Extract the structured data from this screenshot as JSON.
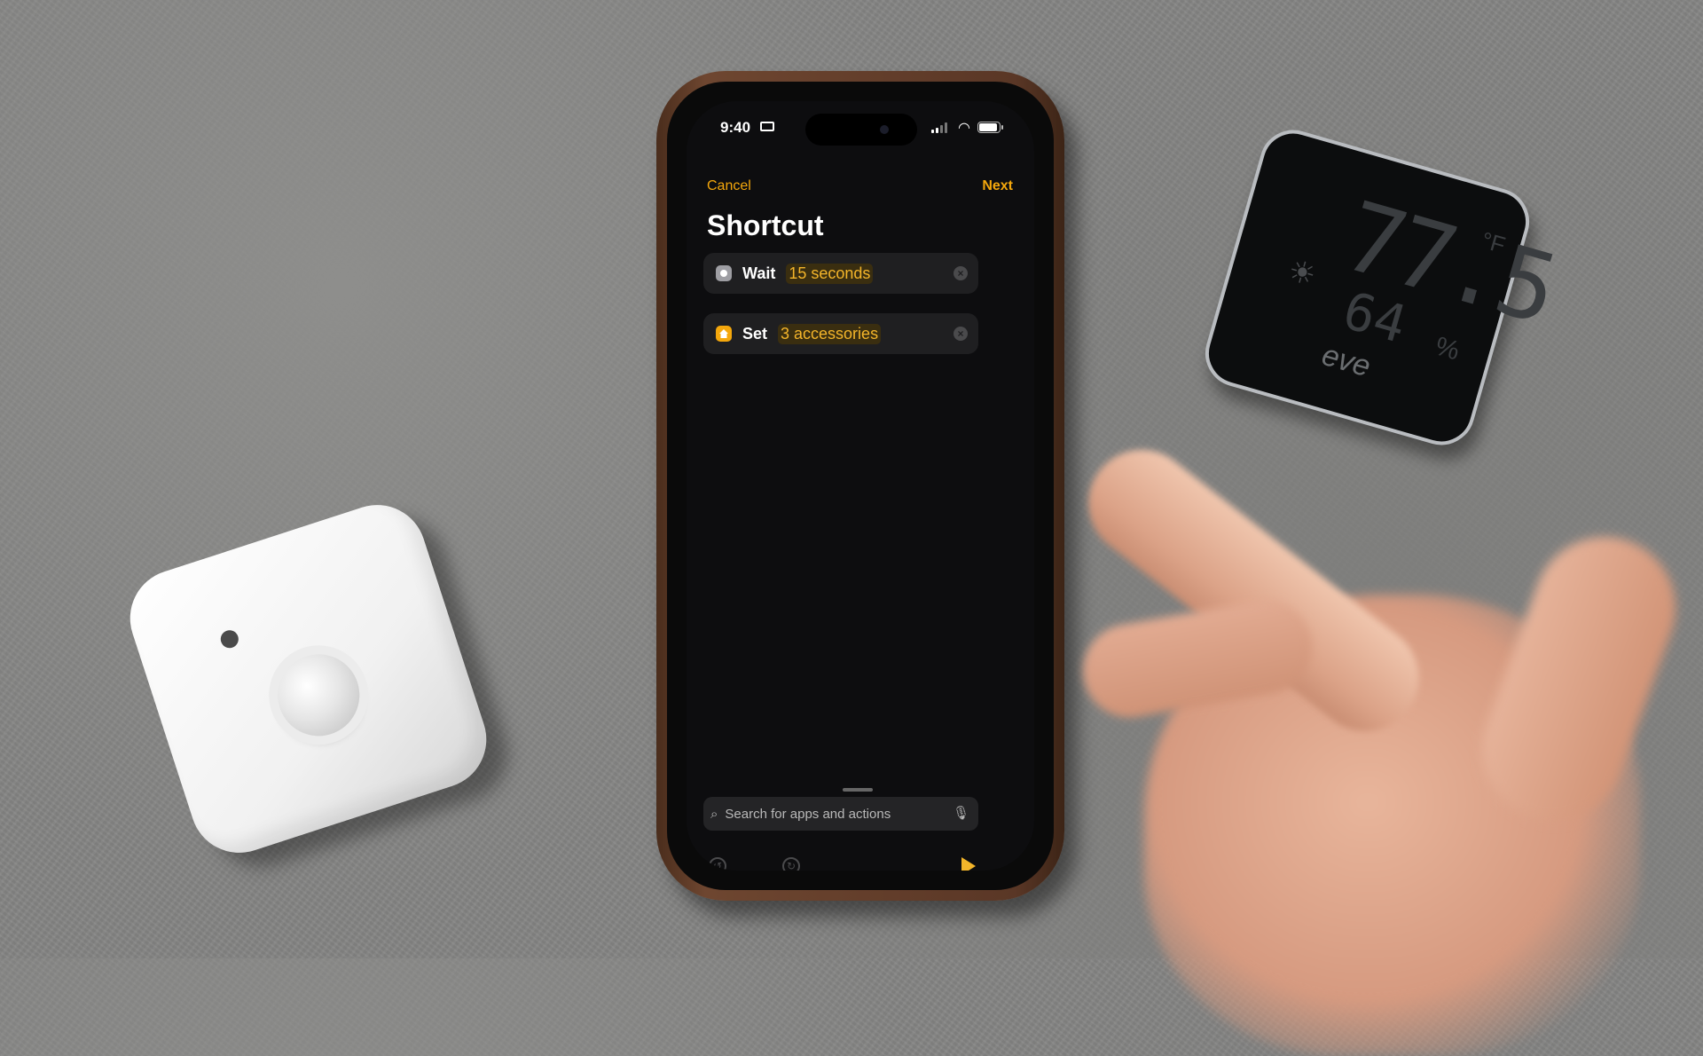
{
  "status_bar": {
    "time": "9:40",
    "signal_icon": "cellular-signal-icon",
    "wifi_icon": "wifi-icon",
    "battery_icon": "battery-icon"
  },
  "nav": {
    "cancel_label": "Cancel",
    "next_label": "Next"
  },
  "page_title": "Shortcut",
  "actions": [
    {
      "verb": "Wait",
      "param": "15 seconds",
      "icon": "stopwatch-icon",
      "icon_color": "#9e9ea3"
    },
    {
      "verb": "Set",
      "param": "3 accessories",
      "icon": "home-icon",
      "icon_color": "#f4a70c"
    }
  ],
  "search": {
    "placeholder": "Search for apps and actions"
  },
  "toolbar": {
    "undo_icon": "undo-icon",
    "redo_icon": "redo-icon",
    "run_icon": "play-icon"
  },
  "colors": {
    "accent": "#f4a70c",
    "background": "#0d0d0f",
    "card": "#1f1f21"
  },
  "eve_display": {
    "temperature": "77.5",
    "temperature_unit": "°F",
    "humidity": "64",
    "humidity_unit": "%",
    "brand": "eve"
  }
}
